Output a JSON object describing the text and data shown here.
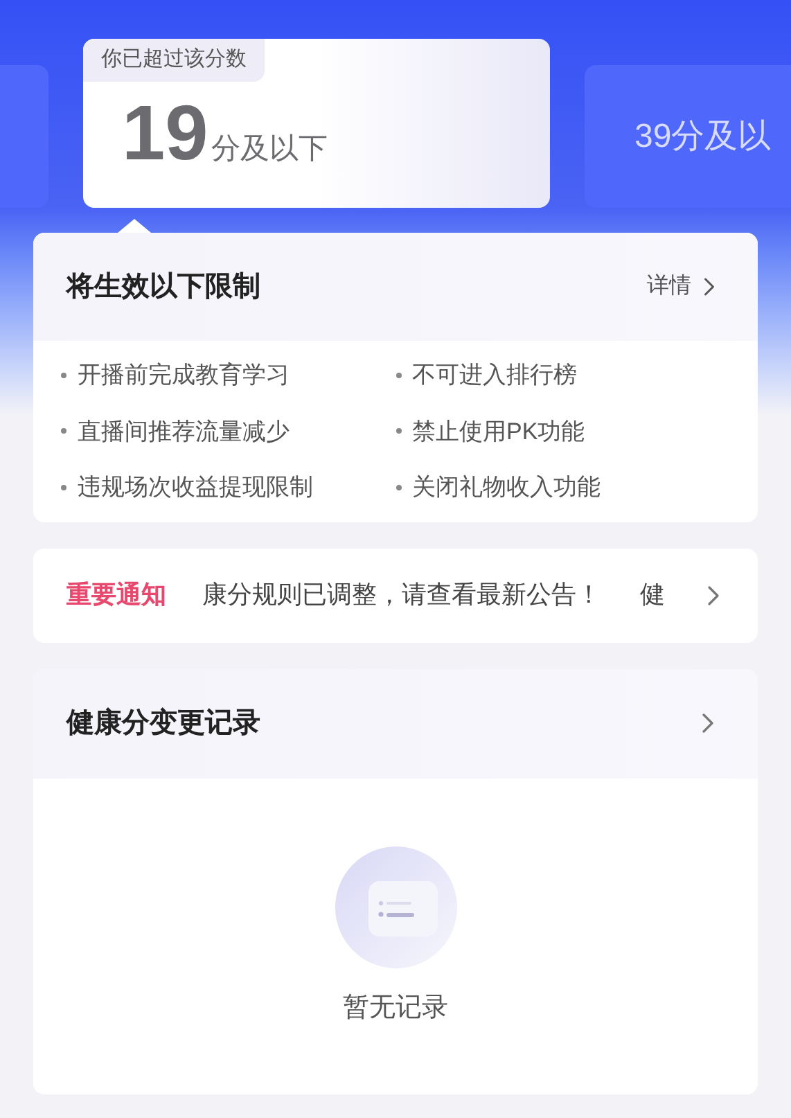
{
  "score_tiers": [
    {
      "badge": "你已超过该分数",
      "score": "19",
      "unit": "分及以下",
      "selected": true
    },
    {
      "label": "39分及以",
      "selected": false
    }
  ],
  "restrictions": {
    "title": "将生效以下限制",
    "detail_link": "详情",
    "items": [
      "开播前完成教育学习",
      "不可进入排行榜",
      "直播间推荐流量减少",
      "禁止使用PK功能",
      "违规场次收益提现限制",
      "关闭礼物收入功能"
    ]
  },
  "notice": {
    "tag": "重要通知",
    "marquee": [
      "康分规则已调整，请查看最新公告！",
      "健"
    ]
  },
  "records": {
    "title": "健康分变更记录",
    "empty_text": "暂无记录"
  }
}
